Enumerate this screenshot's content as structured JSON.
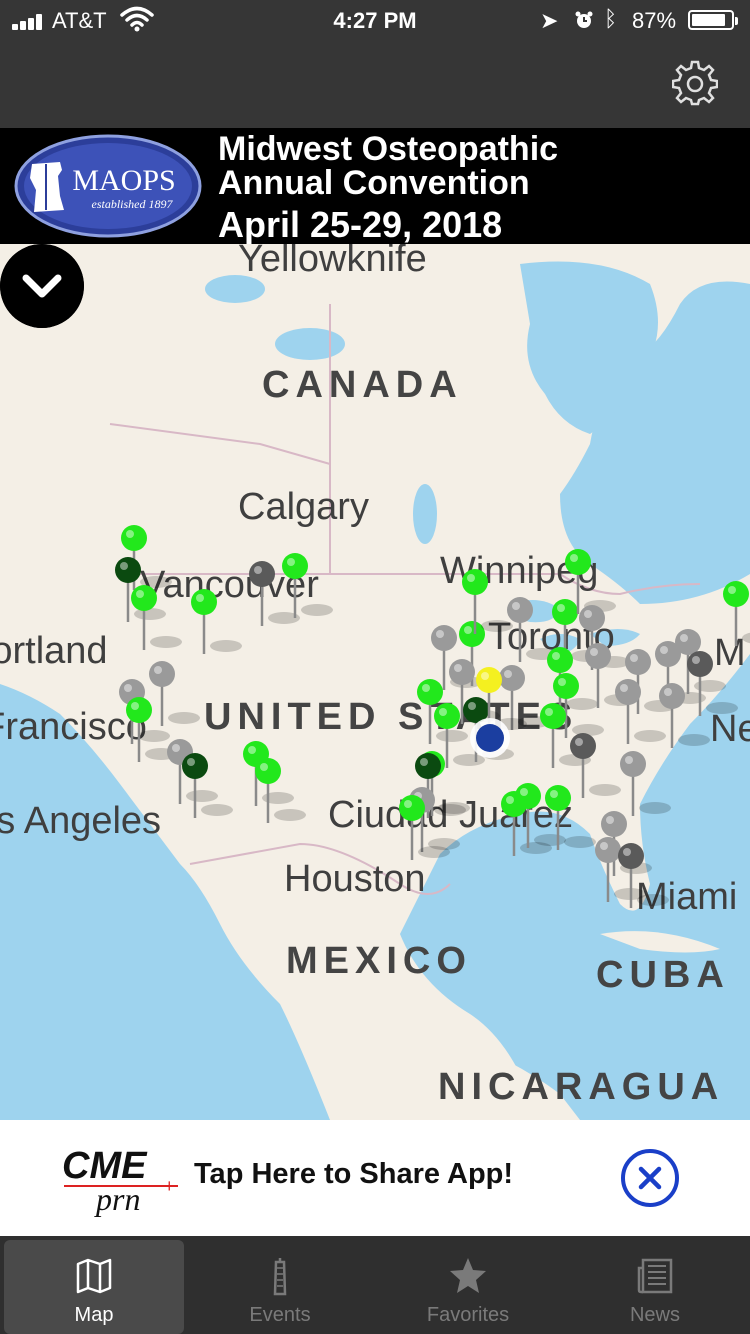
{
  "status_bar": {
    "carrier": "AT&T",
    "time": "4:27 PM",
    "battery_percent": "87%",
    "battery_level": 0.87
  },
  "header": {
    "logo_text": "MAOPS",
    "logo_subtext": "established 1897",
    "line1": "Midwest Osteopathic",
    "line2": "Annual Convention",
    "line3": "April 25-29, 2018"
  },
  "map": {
    "cities": {
      "yellowknife": "Yellowknife",
      "calgary": "Calgary",
      "vancouver": "Vancouver",
      "winnipeg": "Winnipeg",
      "portland": "Portland",
      "toronto": "Toronto",
      "san_francisco": "San Francisco",
      "los_angeles": "Los Angeles",
      "ciudad_juarez": "Ciudad Juarez",
      "houston": "Houston",
      "miami": "Miami",
      "montreal": "M",
      "new_york": "Ne"
    },
    "countries": {
      "canada": "CANADA",
      "united_states": "UNITED STATES",
      "mexico": "MEXICO",
      "cuba": "CUBA",
      "nicaragua": "NICARAGUA"
    },
    "colors": {
      "water": "#9ed3ee",
      "land": "#f4efe6",
      "pin_bright": "#22e81c",
      "pin_dark": "#0b4a10",
      "pin_gray": "#9a9a9a",
      "pin_darkgray": "#5a5a5a",
      "pin_yellow": "#f4f020",
      "user_location": "#1b3ea0"
    }
  },
  "share_bar": {
    "logo_top": "CME",
    "logo_bottom": "prn",
    "text": "Tap Here to Share App!"
  },
  "tabs": [
    {
      "label": "Map",
      "icon": "map-icon",
      "active": true
    },
    {
      "label": "Events",
      "icon": "building-icon",
      "active": false
    },
    {
      "label": "Favorites",
      "icon": "star-icon",
      "active": false
    },
    {
      "label": "News",
      "icon": "newspaper-icon",
      "active": false
    }
  ]
}
